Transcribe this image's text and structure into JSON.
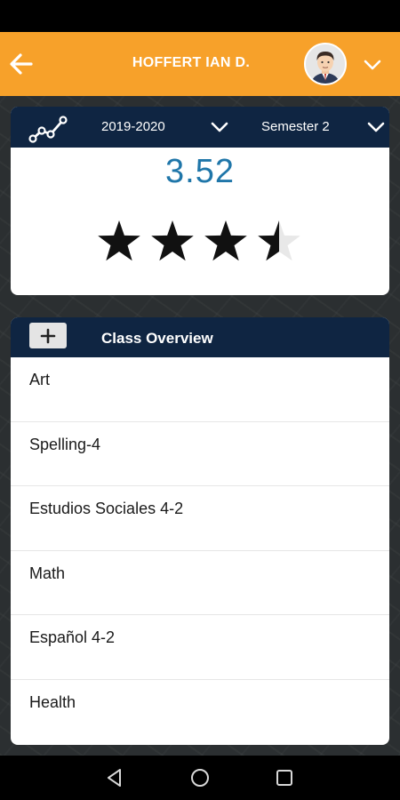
{
  "header": {
    "title": "HOFFERT IAN D.",
    "back_icon": "arrow-left-icon",
    "avatar_icon": "avatar",
    "menu_icon": "chevron-down-icon",
    "accent_color": "#f7a12a"
  },
  "gpa_card": {
    "trend_icon": "trend-chart-icon",
    "school_year": "2019-2020",
    "semester": "Semester 2",
    "gpa": "3.52",
    "rating_stars": 3.5,
    "rating_max": 5,
    "value_color": "#1f76a9",
    "header_color": "#0f2542"
  },
  "overview": {
    "expand_label": "+",
    "title": "Class Overview",
    "classes": [
      "Art",
      "Spelling-4",
      "Estudios Sociales 4-2",
      "Math",
      "Español 4-2",
      "Health"
    ]
  },
  "navigation": {
    "back_icon": "nav-back-icon",
    "home_icon": "nav-home-icon",
    "recents_icon": "nav-recents-icon"
  }
}
